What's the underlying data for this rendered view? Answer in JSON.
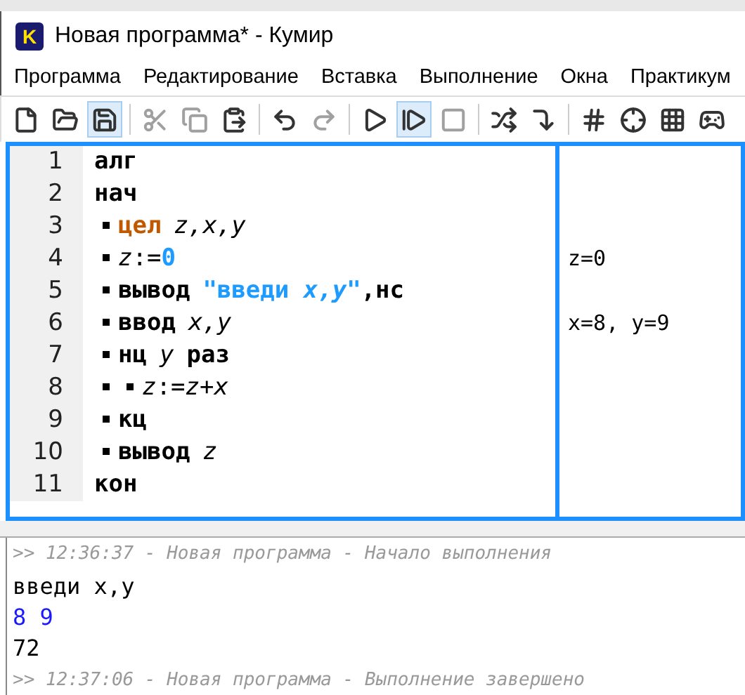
{
  "window": {
    "title": "Новая программа* - Кумир",
    "logo": "K"
  },
  "menu": [
    "Программа",
    "Редактирование",
    "Вставка",
    "Выполнение",
    "Окна",
    "Практикум"
  ],
  "toolbar": [
    {
      "highlighted": false,
      "disabled": false
    },
    {
      "highlighted": false,
      "disabled": false
    },
    {
      "highlighted": true,
      "disabled": false
    },
    {
      "highlighted": false,
      "disabled": true
    },
    {
      "highlighted": false,
      "disabled": true
    },
    {
      "highlighted": false,
      "disabled": false
    },
    {
      "highlighted": false,
      "disabled": false
    },
    {
      "highlighted": false,
      "disabled": true
    },
    {
      "highlighted": false,
      "disabled": false
    },
    {
      "highlighted": true,
      "disabled": false
    },
    {
      "highlighted": false,
      "disabled": true
    },
    {
      "highlighted": false,
      "disabled": false
    },
    {
      "highlighted": false,
      "disabled": false
    },
    {
      "highlighted": false,
      "disabled": false
    },
    {
      "highlighted": false,
      "disabled": false
    },
    {
      "highlighted": false,
      "disabled": false
    },
    {
      "highlighted": false,
      "disabled": false
    }
  ],
  "editor": {
    "lines": [
      {
        "number": "1",
        "tokens": [
          {
            "kind": "keyword",
            "text": "алг"
          }
        ]
      },
      {
        "number": "2",
        "tokens": [
          {
            "kind": "keyword",
            "text": "нач"
          }
        ]
      },
      {
        "number": "3",
        "tokens": [
          {
            "kind": "dot"
          },
          {
            "kind": "type",
            "text": "цел"
          },
          {
            "kind": "variable",
            "text": "z,x,y"
          }
        ]
      },
      {
        "number": "4",
        "margin": "z=0",
        "tokens": [
          {
            "kind": "dot"
          },
          {
            "kind": "variable",
            "text": "z"
          },
          {
            "kind": "plain",
            "text": ":="
          },
          {
            "kind": "literal",
            "text": "0"
          }
        ]
      },
      {
        "number": "5",
        "tokens": [
          {
            "kind": "dot"
          },
          {
            "kind": "keyword",
            "text": "вывод"
          },
          {
            "kind": "literal",
            "text": "\"введи "
          },
          {
            "kind": "literal_italic",
            "text": "x,y"
          },
          {
            "kind": "literal",
            "text": "\""
          },
          {
            "kind": "keyword",
            "text": ",нс"
          }
        ]
      },
      {
        "number": "6",
        "margin": "x=8, y=9",
        "tokens": [
          {
            "kind": "dot"
          },
          {
            "kind": "keyword",
            "text": "ввод"
          },
          {
            "kind": "variable",
            "text": "x,y"
          }
        ]
      },
      {
        "number": "7",
        "tokens": [
          {
            "kind": "dot"
          },
          {
            "kind": "keyword",
            "text": "нц"
          },
          {
            "kind": "variable",
            "text": "y"
          },
          {
            "kind": "keyword",
            "text": "раз"
          }
        ]
      },
      {
        "number": "8",
        "tokens": [
          {
            "kind": "dot"
          },
          {
            "kind": "dot"
          },
          {
            "kind": "variable",
            "text": "z"
          },
          {
            "kind": "plain",
            "text": ":="
          },
          {
            "kind": "variable",
            "text": "z+x"
          }
        ]
      },
      {
        "number": "9",
        "tokens": [
          {
            "kind": "dot"
          },
          {
            "kind": "keyword",
            "text": "кц"
          }
        ]
      },
      {
        "number": "10",
        "tokens": [
          {
            "kind": "dot"
          },
          {
            "kind": "keyword",
            "text": "вывод"
          },
          {
            "kind": "variable",
            "text": "z"
          }
        ]
      },
      {
        "number": "11",
        "tokens": [
          {
            "kind": "keyword",
            "text": "кон"
          }
        ]
      }
    ]
  },
  "console": [
    {
      "kind": "log",
      "text": ">> 12:36:37 - Новая программа - Начало выполнения"
    },
    {
      "kind": "output",
      "text": "введи x,y"
    },
    {
      "kind": "input",
      "text": "8 9"
    },
    {
      "kind": "output",
      "text": "72"
    },
    {
      "kind": "log",
      "text": ">> 12:37:06 - Новая программа - Выполнение завершено"
    }
  ]
}
